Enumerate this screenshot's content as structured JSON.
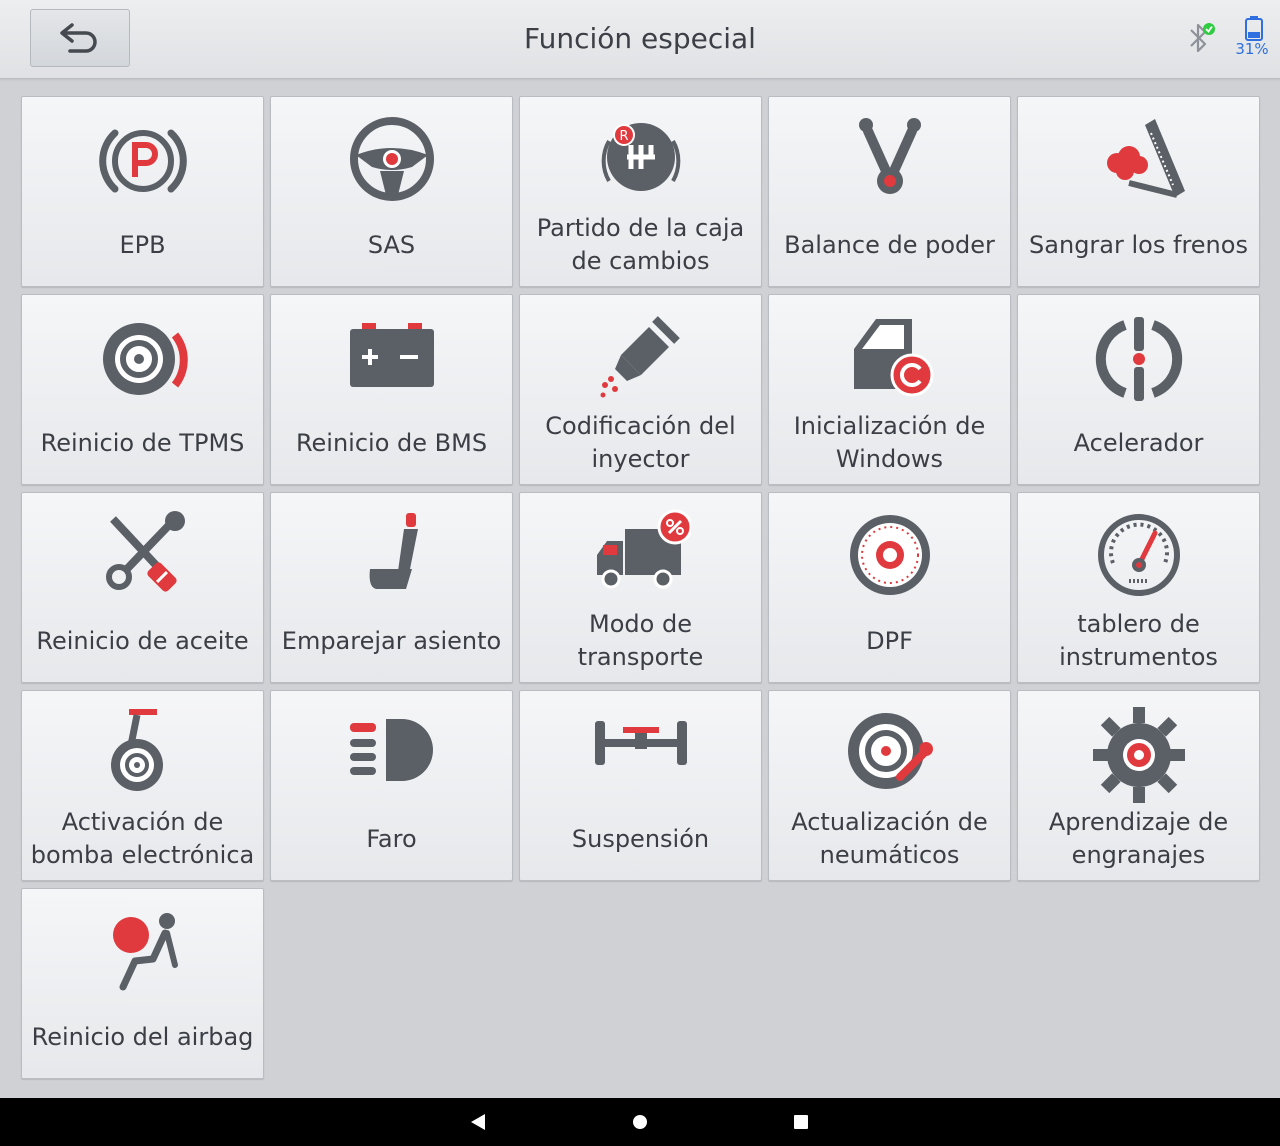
{
  "header": {
    "title": "Función especial",
    "battery_percent": "31%",
    "back_icon": "undo-arrow-icon",
    "bluetooth_icon": "bluetooth-icon",
    "battery_icon": "battery-icon"
  },
  "colors": {
    "accent_red": "#e03a3e",
    "icon_gray": "#5b5f66",
    "battery_blue": "#2f6fe0",
    "check_green": "#2ecc40"
  },
  "tiles": [
    {
      "label": "EPB",
      "icon": "parking-brake-icon"
    },
    {
      "label": "SAS",
      "icon": "steering-wheel-icon"
    },
    {
      "label": "Partido de la caja\nde cambios",
      "icon": "gear-shift-icon"
    },
    {
      "label": "Balance de poder",
      "icon": "engine-balance-icon"
    },
    {
      "label": "Sangrar los frenos",
      "icon": "brake-bleed-icon"
    },
    {
      "label": "Reinicio de TPMS",
      "icon": "tire-pressure-icon"
    },
    {
      "label": "Reinicio de BMS",
      "icon": "car-battery-icon"
    },
    {
      "label": "Codificación del\ninyector",
      "icon": "injector-icon"
    },
    {
      "label": "Inicialización de\nWindows",
      "icon": "car-window-icon"
    },
    {
      "label": "Acelerador",
      "icon": "throttle-icon"
    },
    {
      "label": "Reinicio de aceite",
      "icon": "wrench-oil-icon"
    },
    {
      "label": "Emparejar asiento",
      "icon": "car-seat-icon"
    },
    {
      "label": "Modo de\ntransporte",
      "icon": "truck-icon"
    },
    {
      "label": "DPF",
      "icon": "particulate-filter-icon"
    },
    {
      "label": "tablero de\ninstrumentos",
      "icon": "gauge-icon"
    },
    {
      "label": "Activación de\nbomba electrónica",
      "icon": "pump-icon"
    },
    {
      "label": "Faro",
      "icon": "headlight-icon"
    },
    {
      "label": "Suspensión",
      "icon": "suspension-icon"
    },
    {
      "label": "Actualización de\nneumáticos",
      "icon": "tire-update-icon"
    },
    {
      "label": "Aprendizaje de\nengranajes",
      "icon": "gear-learning-icon"
    },
    {
      "label": "Reinicio del airbag",
      "icon": "airbag-icon"
    }
  ],
  "navbar": {
    "back_icon": "nav-back-icon",
    "home_icon": "nav-home-icon",
    "recent_icon": "nav-recent-icon"
  }
}
